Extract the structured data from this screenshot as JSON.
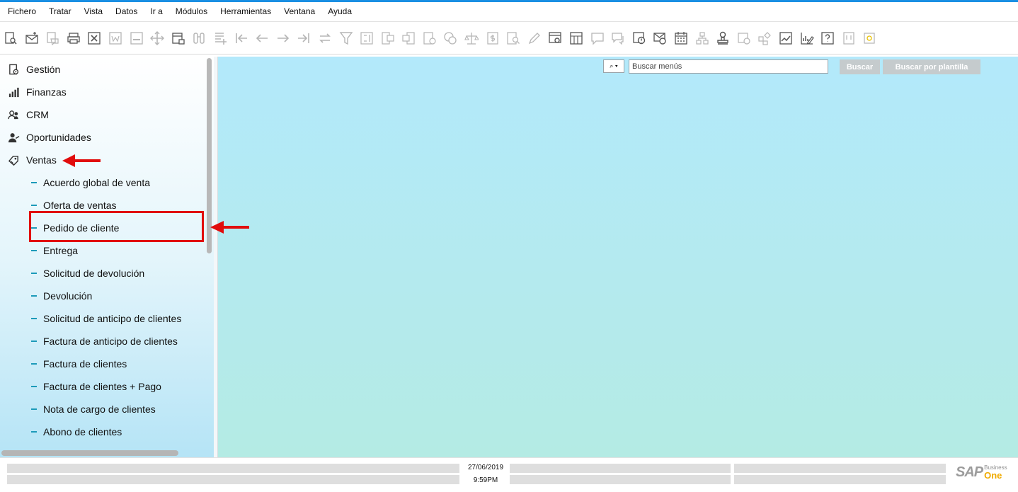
{
  "menubar": {
    "items": [
      "Fichero",
      "Tratar",
      "Vista",
      "Datos",
      "Ir a",
      "Módulos",
      "Herramientas",
      "Ventana",
      "Ayuda"
    ]
  },
  "toolbar": {
    "icons": [
      "doc-search-icon",
      "email-icon",
      "chat-icon",
      "print-icon",
      "excel-icon",
      "word-icon",
      "pdf-icon",
      "move-icon",
      "lock-doc-icon",
      "binoculars-icon",
      "add-doc-icon",
      "first-record-icon",
      "previous-record-icon",
      "next-record-icon",
      "last-record-icon",
      "refresh-icon",
      "filter-icon",
      "sort-icon",
      "copy-from-icon",
      "copy-to-icon",
      "doc-money-icon",
      "payment-icon",
      "balance-icon",
      "dollar-doc-icon",
      "zoom-doc-icon",
      "pen-icon",
      "doc-settings-icon",
      "doc-grid-icon",
      "message-icon",
      "messages-icon",
      "alert-doc-icon",
      "alert-mail-icon",
      "calendar-icon",
      "org-chart-icon",
      "stamp-icon",
      "gauge-icon",
      "widgets-icon",
      "trend-chart-icon",
      "chart-edit-icon",
      "help-icon",
      "window-icon",
      "plugin-icon"
    ]
  },
  "sidebar": {
    "modules": [
      {
        "label": "Gestión",
        "icon": "gestion-icon"
      },
      {
        "label": "Finanzas",
        "icon": "finanzas-icon"
      },
      {
        "label": "CRM",
        "icon": "crm-icon"
      },
      {
        "label": "Oportunidades",
        "icon": "oportunidades-icon"
      },
      {
        "label": "Ventas",
        "icon": "ventas-icon"
      }
    ],
    "ventas_items": [
      "Acuerdo global de venta",
      "Oferta de ventas",
      "Pedido de cliente",
      "Entrega",
      "Solicitud de devolución",
      "Devolución",
      "Solicitud de anticipo de clientes",
      "Factura de anticipo de clientes",
      "Factura de clientes",
      "Factura de clientes + Pago",
      "Nota de cargo de clientes",
      "Abono de clientes"
    ]
  },
  "search": {
    "dropdown_symbol": "⌕ ▾",
    "placeholder": "Buscar menús",
    "value": "",
    "search_button": "Buscar",
    "template_button": "Buscar por plantilla"
  },
  "status": {
    "date": "27/06/2019",
    "time": "9:59PM"
  },
  "brand": {
    "sap": "SAP",
    "business": "Business",
    "one": "One"
  },
  "colors": {
    "accent": "#1a8fe3",
    "highlight": "#e10c0c",
    "sub_dash": "#1c9ab9",
    "brand_one": "#f0ab00"
  }
}
